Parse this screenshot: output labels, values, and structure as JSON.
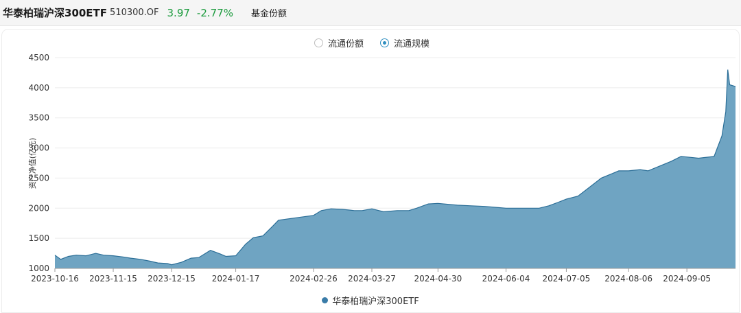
{
  "header": {
    "name": "华泰柏瑞沪深300ETF",
    "code": "510300.OF",
    "price": "3.97",
    "change": "-2.77%",
    "tab": "基金份额"
  },
  "toggles": {
    "share": "流通份额",
    "scale": "流通规模",
    "selected": "scale"
  },
  "colors": {
    "area_fill": "#6fa4c2",
    "line": "#2b6e97",
    "gain": "#1a9a3c"
  },
  "chart_data": {
    "type": "area",
    "ylabel": "资产净值(亿元)",
    "ylim": [
      1000,
      4500
    ],
    "yticks": [
      1000,
      1500,
      2000,
      2500,
      3000,
      3500,
      4000,
      4500
    ],
    "xlim": [
      "2023-10-16",
      "2024-09-30"
    ],
    "xticks": [
      "2023-10-16",
      "2023-11-15",
      "2023-12-15",
      "2024-01-17",
      "2024-02-26",
      "2024-03-27",
      "2024-04-30",
      "2024-06-04",
      "2024-07-05",
      "2024-08-06",
      "2024-09-05"
    ],
    "grid": true,
    "legend": "bottom-center",
    "series": [
      {
        "name": "华泰柏瑞沪深300ETF",
        "x": [
          "2023-10-16",
          "2023-10-19",
          "2023-10-23",
          "2023-10-27",
          "2023-11-01",
          "2023-11-06",
          "2023-11-10",
          "2023-11-15",
          "2023-11-20",
          "2023-11-24",
          "2023-11-29",
          "2023-12-04",
          "2023-12-08",
          "2023-12-13",
          "2023-12-15",
          "2023-12-20",
          "2023-12-25",
          "2023-12-29",
          "2024-01-04",
          "2024-01-09",
          "2024-01-12",
          "2024-01-17",
          "2024-01-22",
          "2024-01-26",
          "2024-01-31",
          "2024-02-05",
          "2024-02-08",
          "2024-02-26",
          "2024-03-01",
          "2024-03-06",
          "2024-03-12",
          "2024-03-18",
          "2024-03-22",
          "2024-03-27",
          "2024-04-02",
          "2024-04-09",
          "2024-04-15",
          "2024-04-19",
          "2024-04-25",
          "2024-04-30",
          "2024-05-10",
          "2024-05-17",
          "2024-05-24",
          "2024-05-31",
          "2024-06-04",
          "2024-06-11",
          "2024-06-17",
          "2024-06-21",
          "2024-06-26",
          "2024-07-01",
          "2024-07-05",
          "2024-07-11",
          "2024-07-17",
          "2024-07-23",
          "2024-07-29",
          "2024-08-01",
          "2024-08-06",
          "2024-08-12",
          "2024-08-16",
          "2024-08-22",
          "2024-08-28",
          "2024-09-02",
          "2024-09-05",
          "2024-09-11",
          "2024-09-19",
          "2024-09-23",
          "2024-09-25",
          "2024-09-26",
          "2024-09-27",
          "2024-09-30"
        ],
        "values": [
          1220,
          1150,
          1200,
          1220,
          1210,
          1250,
          1220,
          1210,
          1190,
          1170,
          1150,
          1120,
          1090,
          1080,
          1060,
          1100,
          1170,
          1180,
          1300,
          1240,
          1200,
          1210,
          1400,
          1510,
          1540,
          1700,
          1800,
          1880,
          1960,
          1990,
          1980,
          1960,
          1960,
          1990,
          1940,
          1960,
          1960,
          2000,
          2070,
          2080,
          2050,
          2040,
          2030,
          2010,
          2000,
          2000,
          2000,
          2000,
          2040,
          2100,
          2150,
          2200,
          2350,
          2500,
          2580,
          2620,
          2620,
          2640,
          2620,
          2700,
          2780,
          2860,
          2850,
          2830,
          2860,
          3200,
          3600,
          4300,
          4050,
          4020
        ]
      }
    ]
  }
}
